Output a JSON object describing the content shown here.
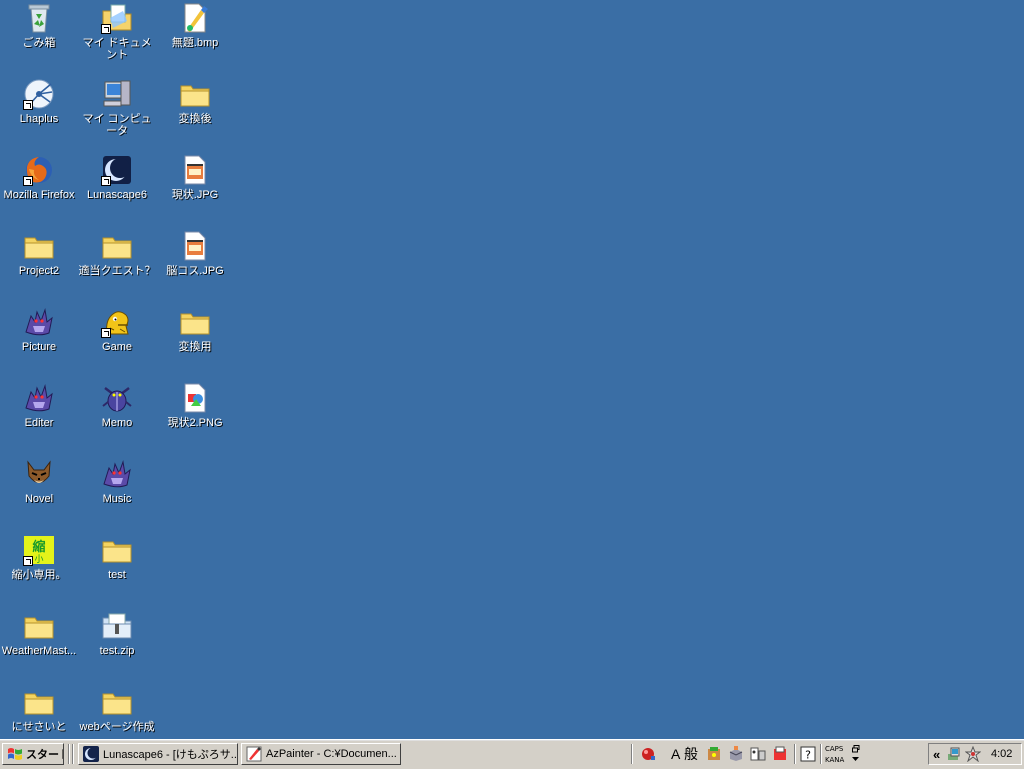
{
  "desktop": {
    "background_color": "#3a6ea5",
    "icons": [
      {
        "label": "ごみ箱",
        "icon": "recycle-bin-icon"
      },
      {
        "label": "マイ ドキュメント",
        "icon": "my-documents-icon"
      },
      {
        "label": "無題.bmp",
        "icon": "bitmap-file-icon"
      },
      {
        "label": "Lhaplus",
        "icon": "lhaplus-icon"
      },
      {
        "label": "マイ コンピュータ",
        "icon": "my-computer-icon"
      },
      {
        "label": "変換後",
        "icon": "folder-icon"
      },
      {
        "label": "Mozilla Firefox",
        "icon": "firefox-icon"
      },
      {
        "label": "Lunascape6",
        "icon": "lunascape-icon"
      },
      {
        "label": "現状.JPG",
        "icon": "jpg-file-icon"
      },
      {
        "label": "Project2",
        "icon": "folder-icon"
      },
      {
        "label": "適当クエスト？",
        "icon": "folder-icon"
      },
      {
        "label": "脳コス.JPG",
        "icon": "jpg-file-icon"
      },
      {
        "label": "Picture",
        "icon": "dragon-icon"
      },
      {
        "label": "Game",
        "icon": "creature-icon"
      },
      {
        "label": "変換用",
        "icon": "folder-icon"
      },
      {
        "label": "Editer",
        "icon": "dragon-icon"
      },
      {
        "label": "Memo",
        "icon": "beetle-icon"
      },
      {
        "label": "現状2.PNG",
        "icon": "png-file-icon"
      },
      {
        "label": "Novel",
        "icon": "wolf-icon"
      },
      {
        "label": "Music",
        "icon": "dragon-icon"
      },
      {
        "label": "縮小専用。",
        "icon": "resize-tool-icon"
      },
      {
        "label": "test",
        "icon": "folder-icon"
      },
      {
        "label": "WeatherMast...",
        "icon": "folder-icon"
      },
      {
        "label": "test.zip",
        "icon": "zip-folder-icon"
      },
      {
        "label": "にせさいと",
        "icon": "folder-icon"
      },
      {
        "label": "webページ作成",
        "icon": "folder-icon"
      }
    ]
  },
  "taskbar": {
    "start_label": "スタート",
    "tasks": [
      {
        "label": "Lunascape6 - [けもぷろサ...",
        "icon": "lunascape-icon"
      },
      {
        "label": "AzPainter - C:¥Documen...",
        "icon": "azpainter-icon"
      }
    ],
    "ime": {
      "mode_char": "A",
      "mode_label": "般",
      "caps": "CAPS",
      "kana": "KANA"
    },
    "tray": {
      "expand_label": "«",
      "clock": "4:02"
    }
  }
}
